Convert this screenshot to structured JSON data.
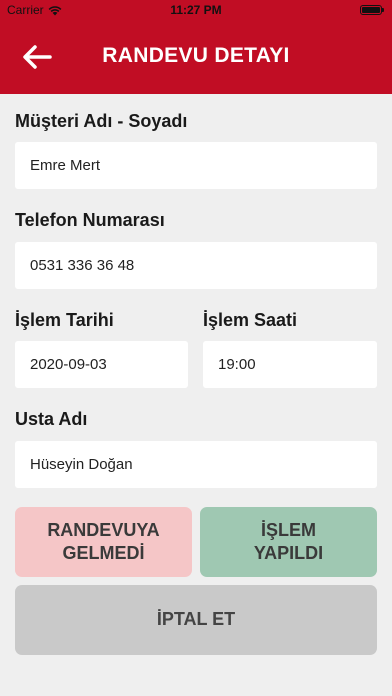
{
  "status_bar": {
    "carrier": "Carrier",
    "time": "11:27 PM",
    "battery_level": 1.0
  },
  "header": {
    "title": "RANDEVU DETAYI",
    "back_icon": "arrow-left-icon"
  },
  "form": {
    "customer_label": "Müşteri Adı - Soyadı",
    "customer_value": "Emre Mert",
    "phone_label": "Telefon Numarası",
    "phone_value": "0531 336 36 48",
    "date_label": "İşlem Tarihi",
    "date_value": "2020-09-03",
    "time_label": "İşlem Saati",
    "time_value": "19:00",
    "master_label": "Usta Adı",
    "master_value": "Hüseyin Doğan"
  },
  "actions": {
    "no_show_label": "RANDEVUYA\nGELMEDİ",
    "done_label": "İŞLEM\nYAPILDI",
    "cancel_label": "İPTAL ET"
  },
  "colors": {
    "brand": "#c10d24",
    "no_show_bg": "#f5c6c7",
    "done_bg": "#9fc8b2",
    "cancel_bg": "#c9c9c9",
    "background": "#efefef"
  }
}
